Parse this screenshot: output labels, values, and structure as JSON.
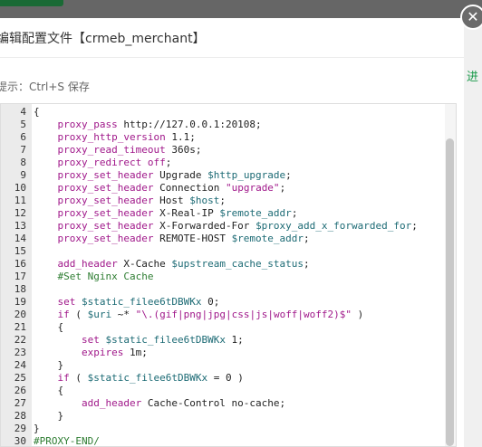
{
  "dialog": {
    "title": "编辑配置文件【crmeb_merchant】",
    "hint": "提示：Ctrl+S 保存",
    "close_symbol": "✕"
  },
  "side": {
    "fragment": "进"
  },
  "editor": {
    "lines": [
      {
        "num": "4",
        "tokens": [
          [
            "n",
            "{"
          ]
        ]
      },
      {
        "num": "5",
        "tokens": [
          [
            "n",
            "    "
          ],
          [
            "d",
            "proxy_pass"
          ],
          [
            "n",
            " http://127.0.0.1:20108;"
          ]
        ]
      },
      {
        "num": "6",
        "tokens": [
          [
            "n",
            "    "
          ],
          [
            "d",
            "proxy_http_version"
          ],
          [
            "n",
            " 1.1;"
          ]
        ]
      },
      {
        "num": "7",
        "tokens": [
          [
            "n",
            "    "
          ],
          [
            "d",
            "proxy_read_timeout"
          ],
          [
            "n",
            " 360s;"
          ]
        ]
      },
      {
        "num": "8",
        "tokens": [
          [
            "n",
            "    "
          ],
          [
            "d",
            "proxy_redirect"
          ],
          [
            "n",
            " "
          ],
          [
            "s",
            "off"
          ],
          [
            "n",
            ";"
          ]
        ]
      },
      {
        "num": "9",
        "tokens": [
          [
            "n",
            "    "
          ],
          [
            "d",
            "proxy_set_header"
          ],
          [
            "n",
            " Upgrade "
          ],
          [
            "v",
            "$http_upgrade"
          ],
          [
            "n",
            ";"
          ]
        ]
      },
      {
        "num": "10",
        "tokens": [
          [
            "n",
            "    "
          ],
          [
            "d",
            "proxy_set_header"
          ],
          [
            "n",
            " Connection "
          ],
          [
            "s",
            "\"upgrade\""
          ],
          [
            "n",
            ";"
          ]
        ]
      },
      {
        "num": "11",
        "tokens": [
          [
            "n",
            "    "
          ],
          [
            "d",
            "proxy_set_header"
          ],
          [
            "n",
            " Host "
          ],
          [
            "v",
            "$host"
          ],
          [
            "n",
            ";"
          ]
        ]
      },
      {
        "num": "12",
        "tokens": [
          [
            "n",
            "    "
          ],
          [
            "d",
            "proxy_set_header"
          ],
          [
            "n",
            " X-Real-IP "
          ],
          [
            "v",
            "$remote_addr"
          ],
          [
            "n",
            ";"
          ]
        ]
      },
      {
        "num": "13",
        "tokens": [
          [
            "n",
            "    "
          ],
          [
            "d",
            "proxy_set_header"
          ],
          [
            "n",
            " X-Forwarded-For "
          ],
          [
            "v",
            "$proxy_add_x_forwarded_for"
          ],
          [
            "n",
            ";"
          ]
        ]
      },
      {
        "num": "14",
        "tokens": [
          [
            "n",
            "    "
          ],
          [
            "d",
            "proxy_set_header"
          ],
          [
            "n",
            " REMOTE-HOST "
          ],
          [
            "v",
            "$remote_addr"
          ],
          [
            "n",
            ";"
          ]
        ]
      },
      {
        "num": "15",
        "tokens": [
          [
            "n",
            ""
          ]
        ]
      },
      {
        "num": "16",
        "tokens": [
          [
            "n",
            "    "
          ],
          [
            "d",
            "add_header"
          ],
          [
            "n",
            " X-Cache "
          ],
          [
            "v",
            "$upstream_cache_status"
          ],
          [
            "n",
            ";"
          ]
        ]
      },
      {
        "num": "17",
        "tokens": [
          [
            "n",
            "    "
          ],
          [
            "c",
            "#Set Nginx Cache"
          ]
        ]
      },
      {
        "num": "18",
        "tokens": [
          [
            "n",
            ""
          ]
        ]
      },
      {
        "num": "19",
        "tokens": [
          [
            "n",
            "    "
          ],
          [
            "d",
            "set"
          ],
          [
            "n",
            " "
          ],
          [
            "v",
            "$static_filee6tDBWKx"
          ],
          [
            "n",
            " 0;"
          ]
        ]
      },
      {
        "num": "20",
        "tokens": [
          [
            "n",
            "    "
          ],
          [
            "d",
            "if"
          ],
          [
            "n",
            " ( "
          ],
          [
            "v",
            "$uri"
          ],
          [
            "n",
            " ~* "
          ],
          [
            "s",
            "\"\\.(gif|png|jpg|css|js|woff|woff2)$\""
          ],
          [
            "n",
            " )"
          ]
        ]
      },
      {
        "num": "21",
        "tokens": [
          [
            "n",
            "    {"
          ]
        ]
      },
      {
        "num": "22",
        "tokens": [
          [
            "n",
            "        "
          ],
          [
            "d",
            "set"
          ],
          [
            "n",
            " "
          ],
          [
            "v",
            "$static_filee6tDBWKx"
          ],
          [
            "n",
            " 1;"
          ]
        ]
      },
      {
        "num": "23",
        "tokens": [
          [
            "n",
            "        "
          ],
          [
            "d",
            "expires"
          ],
          [
            "n",
            " 1m;"
          ]
        ]
      },
      {
        "num": "24",
        "tokens": [
          [
            "n",
            "    }"
          ]
        ]
      },
      {
        "num": "25",
        "tokens": [
          [
            "n",
            "    "
          ],
          [
            "d",
            "if"
          ],
          [
            "n",
            " ( "
          ],
          [
            "v",
            "$static_filee6tDBWKx"
          ],
          [
            "n",
            " = 0 )"
          ]
        ]
      },
      {
        "num": "26",
        "tokens": [
          [
            "n",
            "    {"
          ]
        ]
      },
      {
        "num": "27",
        "tokens": [
          [
            "n",
            "        "
          ],
          [
            "d",
            "add_header"
          ],
          [
            "n",
            " Cache-Control no-cache;"
          ]
        ]
      },
      {
        "num": "28",
        "tokens": [
          [
            "n",
            "    }"
          ]
        ]
      },
      {
        "num": "29",
        "tokens": [
          [
            "n",
            "}"
          ]
        ]
      },
      {
        "num": "30",
        "tokens": [
          [
            "c",
            "#PROXY-END/"
          ]
        ]
      }
    ]
  }
}
